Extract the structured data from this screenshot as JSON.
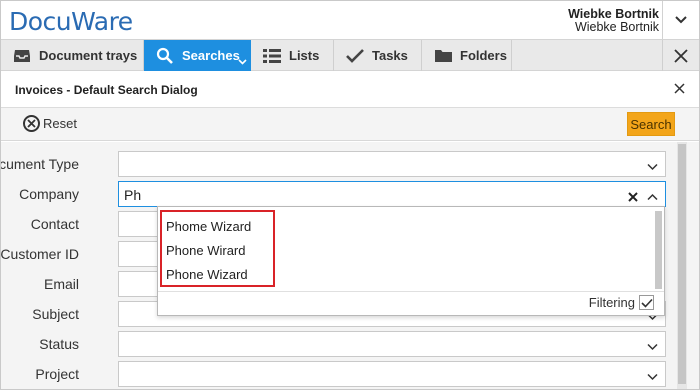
{
  "brand": {
    "logo": "DocuWare"
  },
  "user": {
    "name_bold": "Wiebke Bortnik",
    "name": "Wiebke Bortnik"
  },
  "nav": {
    "items": [
      {
        "label": "Document trays",
        "icon": "tray-icon"
      },
      {
        "label": "Searches",
        "icon": "search-icon",
        "active": true
      },
      {
        "label": "Lists",
        "icon": "list-icon"
      },
      {
        "label": "Tasks",
        "icon": "checkmark-icon"
      },
      {
        "label": "Folders",
        "icon": "folder-icon"
      }
    ]
  },
  "dialog": {
    "title": "Invoices - Default Search Dialog"
  },
  "toolbar": {
    "reset_label": "Reset",
    "search_label": "Search"
  },
  "form": {
    "fields": [
      {
        "label": "Document Type",
        "value": ""
      },
      {
        "label": "Company",
        "value": "Ph"
      },
      {
        "label": "Contact",
        "value": ""
      },
      {
        "label": "Customer ID",
        "value": ""
      },
      {
        "label": "Email",
        "value": ""
      },
      {
        "label": "Subject",
        "value": ""
      },
      {
        "label": "Status",
        "value": ""
      },
      {
        "label": "Project",
        "value": ""
      }
    ]
  },
  "dropdown": {
    "options": [
      "Phome Wizard",
      "Phone Wirard",
      "Phone Wizard"
    ],
    "filtering_label": "Filtering",
    "filtering_checked": true
  },
  "colors": {
    "accent": "#1e8fe0",
    "search_button": "#f3a51a",
    "highlight": "#d92328"
  }
}
